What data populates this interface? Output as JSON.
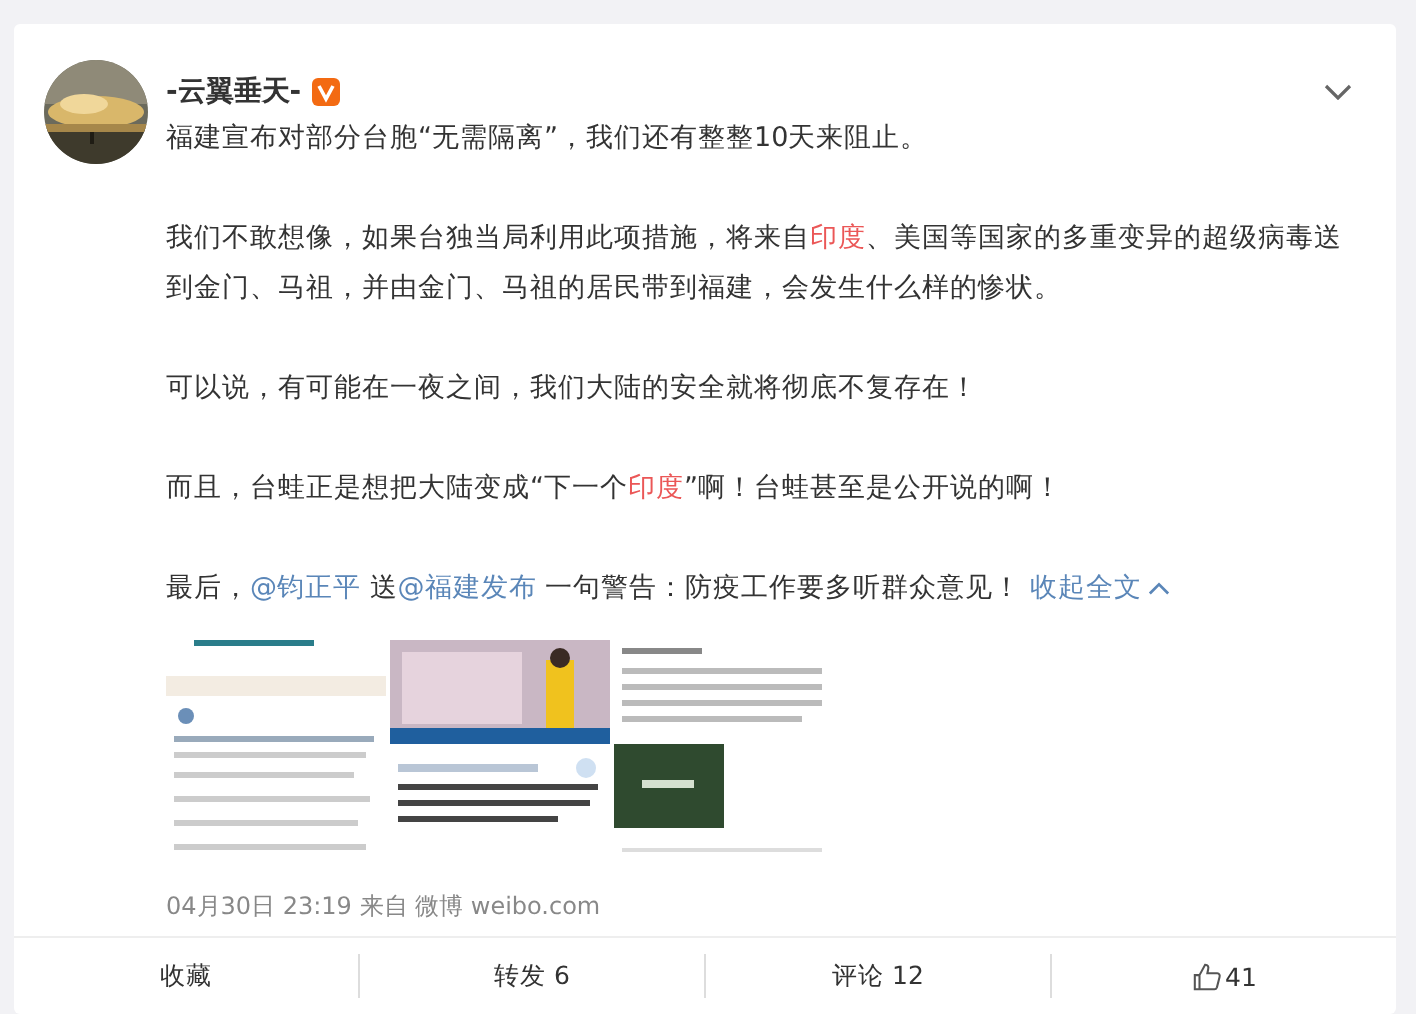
{
  "post": {
    "author": "-云翼垂天-",
    "verified": true,
    "paragraphs": [
      [
        {
          "kind": "text",
          "text": "福建宣布对部分台胞“无需隔离”，我们还有整整10天来阻止。"
        }
      ],
      [
        {
          "kind": "text",
          "text": "我们不敢想像，如果台独当局利用此项措施，将来自"
        },
        {
          "kind": "highlight",
          "text": "印度"
        },
        {
          "kind": "text",
          "text": "、美国等国家的多重变异的超级病毒送到金门、马祖，并由金门、马祖的居民带到福建，会发生什么样的惨状。"
        }
      ],
      [
        {
          "kind": "text",
          "text": "可以说，有可能在一夜之间，我们大陆的安全就将彻底不复存在！"
        }
      ],
      [
        {
          "kind": "text",
          "text": "而且，台蛙正是想把大陆变成“下一个"
        },
        {
          "kind": "highlight",
          "text": "印度"
        },
        {
          "kind": "text",
          "text": "”啊！台蛙甚至是公开说的啊！"
        }
      ],
      [
        {
          "kind": "text",
          "text": "最后，"
        },
        {
          "kind": "mention",
          "text": "@钧正平"
        },
        {
          "kind": "text",
          "text": " 送"
        },
        {
          "kind": "mention",
          "text": "@福建发布"
        },
        {
          "kind": "text",
          "text": " 一句警告：防疫工作要多听群众意见！ "
        },
        {
          "kind": "collapse",
          "text": "收起全文"
        }
      ]
    ],
    "images": [
      {
        "kind": "picture"
      },
      {
        "kind": "picture"
      },
      {
        "kind": "picture"
      }
    ],
    "meta": "04月30日 23:19  来自 微博 weibo.com"
  },
  "actions": [
    {
      "kind": "favorite",
      "label": "收藏"
    },
    {
      "kind": "repost",
      "label": "转发 6"
    },
    {
      "kind": "comment",
      "label": "评论 12"
    },
    {
      "kind": "like",
      "label": "41"
    }
  ]
}
